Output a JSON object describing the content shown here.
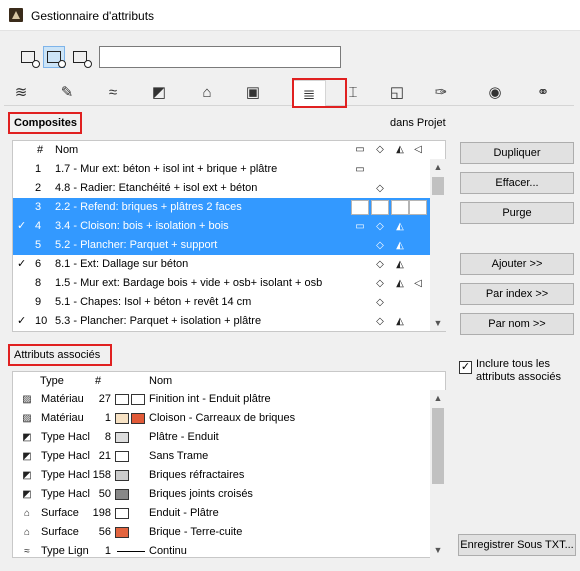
{
  "window": {
    "title": "Gestionnaire d'attributs"
  },
  "search": {
    "value": ""
  },
  "tabs": [
    {
      "icon": "layers-icon",
      "glyph": "≋"
    },
    {
      "icon": "pen-icon",
      "glyph": "✎"
    },
    {
      "icon": "line-type-icon",
      "glyph": "≈"
    },
    {
      "icon": "fill-icon",
      "glyph": "◩"
    },
    {
      "icon": "surface-brush-icon",
      "glyph": "⌂"
    },
    {
      "icon": "building-material-icon",
      "glyph": "▣"
    },
    {
      "icon": "composite-icon",
      "glyph": "≣"
    },
    {
      "icon": "profile-icon",
      "glyph": "⌶"
    },
    {
      "icon": "zone-category-icon",
      "glyph": "◱"
    },
    {
      "icon": "markup-style-icon",
      "glyph": "✑"
    },
    {
      "icon": "globe-icon",
      "glyph": "◉"
    },
    {
      "icon": "link-icon",
      "glyph": "⚭"
    }
  ],
  "composites": {
    "section_label": "Composites",
    "in_project_label": "dans Projet",
    "columns": {
      "num": "#",
      "name": "Nom"
    },
    "rows": [
      {
        "check": "",
        "num": "1",
        "name": "1.7 - Mur ext: béton + isol int + brique + plâtre",
        "selected": false,
        "icons": [
          "▭",
          "",
          "",
          ""
        ]
      },
      {
        "check": "",
        "num": "2",
        "name": "4.8 - Radier: Etanchéité + isol ext + béton",
        "selected": false,
        "icons": [
          "",
          "◇",
          "",
          ""
        ]
      },
      {
        "check": "",
        "num": "3",
        "name": "2.2 - Refend: briques + plâtres 2 faces",
        "selected": true,
        "icons": [
          "▭",
          "▢",
          "▢",
          "▢"
        ]
      },
      {
        "check": "✓",
        "num": "4",
        "name": "3.4 - Cloison: bois + isolation + bois",
        "selected": true,
        "icons": [
          "▭",
          "◇",
          "◭",
          ""
        ]
      },
      {
        "check": "",
        "num": "5",
        "name": "5.2 - Plancher: Parquet + support",
        "selected": true,
        "icons": [
          "",
          "◇",
          "◭",
          ""
        ]
      },
      {
        "check": "✓",
        "num": "6",
        "name": "8.1 - Ext: Dallage sur béton",
        "selected": false,
        "icons": [
          "",
          "◇",
          "◭",
          ""
        ]
      },
      {
        "check": "",
        "num": "8",
        "name": "1.5 - Mur ext: Bardage bois + vide + osb+ isolant + osb",
        "selected": false,
        "icons": [
          "",
          "◇",
          "◭",
          "◁"
        ]
      },
      {
        "check": "",
        "num": "9",
        "name": "5.1 - Chapes: Isol + béton + revêt 14 cm",
        "selected": false,
        "icons": [
          "",
          "◇",
          "",
          ""
        ]
      },
      {
        "check": "✓",
        "num": "10",
        "name": "5.3 - Plancher: Parquet + isolation + plâtre",
        "selected": false,
        "icons": [
          "",
          "◇",
          "◭",
          ""
        ]
      }
    ]
  },
  "associated": {
    "section_label": "Attributs associés",
    "columns": {
      "type": "Type",
      "num": "#",
      "name": "Nom"
    },
    "rows": [
      {
        "icon": "▨",
        "type": "Matériau",
        "num": "27",
        "swatch1": "#ffffff",
        "swatch2": "#ffffff",
        "name": "Finition int - Enduit plâtre"
      },
      {
        "icon": "▨",
        "type": "Matériau",
        "num": "1",
        "swatch1": "#f7e2c4",
        "swatch2": "#e15a38",
        "name": "Cloison - Carreaux de briques"
      },
      {
        "icon": "◩",
        "type": "Type Hacl",
        "num": "8",
        "swatch1": "#dddddd",
        "swatch2": "",
        "name": "Plâtre - Enduit"
      },
      {
        "icon": "◩",
        "type": "Type Hacl",
        "num": "21",
        "swatch1": "#ffffff",
        "swatch2": "",
        "name": "Sans Trame"
      },
      {
        "icon": "◩",
        "type": "Type Hacl",
        "num": "158",
        "swatch1": "#cccccc",
        "swatch2": "",
        "name": "Briques réfractaires"
      },
      {
        "icon": "◩",
        "type": "Type Hacl",
        "num": "50",
        "swatch1": "#888888",
        "swatch2": "",
        "name": "Briques joints croisés"
      },
      {
        "icon": "⌂",
        "type": "Surface",
        "num": "198",
        "swatch1": "#ffffff",
        "swatch2": "",
        "name": "Enduit - Plâtre"
      },
      {
        "icon": "⌂",
        "type": "Surface",
        "num": "56",
        "swatch1": "#e2643f",
        "swatch2": "",
        "name": "Brique - Terre-cuite"
      },
      {
        "icon": "≈",
        "type": "Type Lign",
        "num": "1",
        "swatch1": "line",
        "swatch2": "",
        "name": "Continu"
      }
    ],
    "include_all_label": "Inclure tous les attributs associés",
    "include_all_checked": true
  },
  "buttons": {
    "duplicate": "Dupliquer",
    "delete": "Effacer...",
    "purge": "Purge",
    "add": "Ajouter >>",
    "by_index": "Par index >>",
    "by_name": "Par nom >>",
    "save_as": "Enregistrer Sous TXT..."
  },
  "colors": {
    "selection": "#3399ff",
    "highlight": "#e02020"
  }
}
